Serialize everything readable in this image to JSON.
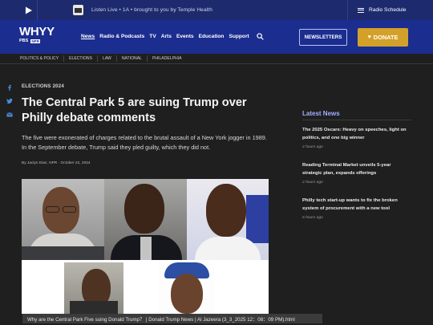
{
  "livebar": {
    "live_text": "Listen Live • 1A • brought to you by Temple Health",
    "radio_schedule": "Radio Schedule"
  },
  "nav": {
    "logo_text": "WHYY",
    "logo_sub_pbs": "PBS",
    "logo_sub_npr": "NPR",
    "links": [
      "News",
      "Radio & Podcasts",
      "TV",
      "Arts",
      "Events",
      "Education",
      "Support"
    ],
    "newsletters": "NEWSLETTERS",
    "donate": "DONATE"
  },
  "subnav": [
    "POLITICS & POLICY",
    "ELECTIONS",
    "LAW",
    "NATIONAL",
    "PHILADELPHIA"
  ],
  "article": {
    "kicker": "ELECTIONS 2024",
    "headline": "The Central Park 5 are suing Trump over Philly debate comments",
    "dek": "The five were exonerated of charges related to the brutal assault of a New York jogger in 1989. In the September debate, Trump said they pled guilty, which they did not.",
    "byline": "By Jaclyn Diaz, NPR · October 22, 2024"
  },
  "latest": {
    "heading": "Latest News",
    "items": [
      {
        "title": "The 2025 Oscars: Heavy on speeches, light on politics, and one big winner",
        "ago": "2 hours ago"
      },
      {
        "title": "Reading Terminal Market unveils 5-year strategic plan, expands offerings",
        "ago": "2 hours ago"
      },
      {
        "title": "Philly tech start-up wants to fix the broken system of procurement with a new tool",
        "ago": "6 hours ago"
      }
    ]
  },
  "statusbar": {
    "text": "Why are the Central Park Five suing Donald Trump？ | Donald Trump News | Al Jazeera (3_3_2025 12：08：09 PM).html"
  },
  "colors": {
    "livebar_bg": "#1d2a6e",
    "nav_bg": "#1b2d8f",
    "donate_bg": "#d3a12a",
    "latest_heading": "#9fb0ff",
    "page_bg": "#1f1f1f"
  }
}
